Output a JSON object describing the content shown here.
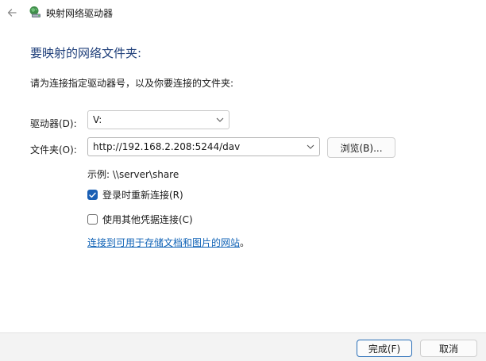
{
  "window": {
    "title": "映射网络驱动器",
    "icon": "network-drive-icon"
  },
  "heading": "要映射的网络文件夹:",
  "instruction": "请为连接指定驱动器号，以及你要连接的文件夹:",
  "drive": {
    "label": "驱动器(D):",
    "value": "V:"
  },
  "folder": {
    "label": "文件夹(O):",
    "value": "http://192.168.2.208:5244/dav",
    "browse_label": "浏览(B)..."
  },
  "example": "示例: \\\\server\\share",
  "reconnect": {
    "label": "登录时重新连接(R)",
    "checked": true
  },
  "credentials": {
    "label": "使用其他凭据连接(C)",
    "checked": false
  },
  "link": {
    "text": "连接到可用于存储文档和图片的网站",
    "suffix": "。"
  },
  "buttons": {
    "finish": "完成(F)",
    "cancel": "取消"
  },
  "colors": {
    "heading": "#1f3f7a",
    "accent": "#1a5fb4",
    "link": "#0f62b6"
  }
}
